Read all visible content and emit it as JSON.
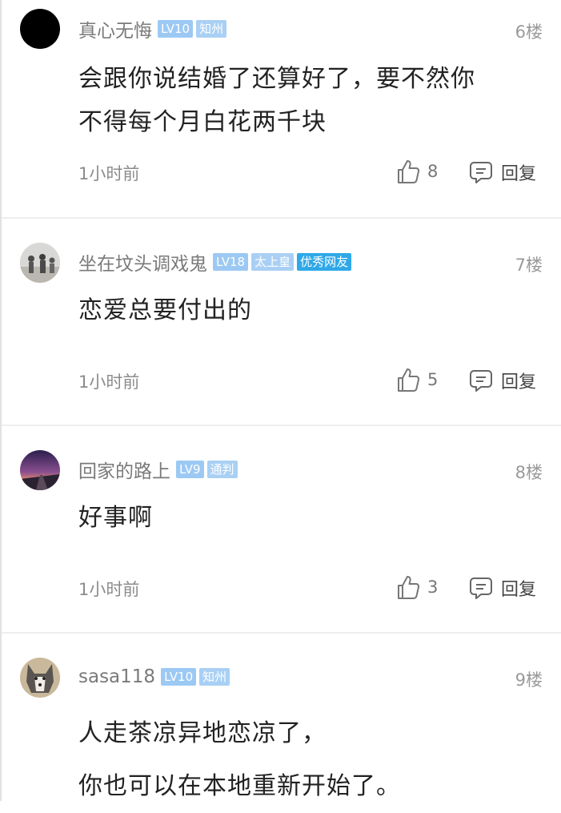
{
  "comments": [
    {
      "username": "真心无悔",
      "level": "LV10",
      "title": "知州",
      "floor": "6楼",
      "lines": [
        "会跟你说结婚了还算好了，要不然你",
        "不得每个月白花两千块"
      ],
      "time": "1小时前",
      "likes": "8",
      "reply_label": "回复",
      "avatar_icon": "black-circle-avatar"
    },
    {
      "username": "坐在坟头调戏鬼",
      "level": "LV18",
      "title": "太上皇",
      "extra_badge": "优秀网友",
      "floor": "7楼",
      "lines": [
        "恋爱总要付出的"
      ],
      "time": "1小时前",
      "likes": "5",
      "reply_label": "回复",
      "avatar_icon": "people-photo-avatar"
    },
    {
      "username": "回家的路上",
      "level": "LV9",
      "title": "通判",
      "floor": "8楼",
      "lines": [
        "好事啊"
      ],
      "time": "1小时前",
      "likes": "3",
      "reply_label": "回复",
      "avatar_icon": "sunset-road-avatar"
    },
    {
      "username": "sasa118",
      "level": "LV10",
      "title": "知州",
      "floor": "9楼",
      "lines": [
        "人走茶凉异地恋凉了，",
        "你也可以在本地重新开始了。"
      ],
      "avatar_icon": "husky-dog-avatar"
    }
  ],
  "colors": {
    "badge_level": "#9cc9f3",
    "badge_excellent": "#2fa8e8",
    "divider": "#eeeeee"
  },
  "icons": {
    "like": "thumbs-up-icon",
    "reply": "comment-bubble-icon"
  }
}
